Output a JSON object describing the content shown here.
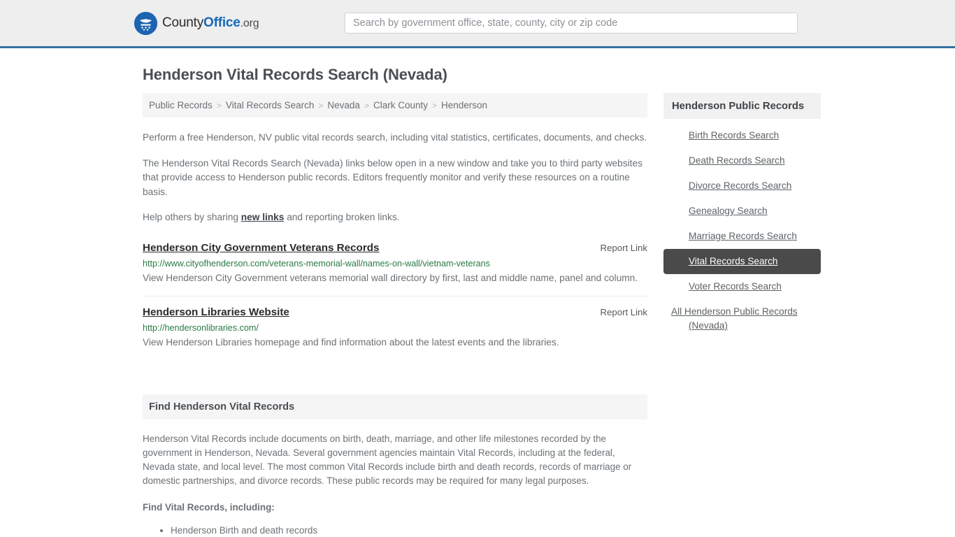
{
  "header": {
    "brand": {
      "part1": "County",
      "part2": "Office",
      "part3": ".org",
      "icon": "eagle-shield-logo"
    },
    "search": {
      "placeholder": "Search by government office, state, county, city or zip code",
      "value": ""
    }
  },
  "page": {
    "title": "Henderson Vital Records Search (Nevada)"
  },
  "breadcrumb": {
    "items": [
      {
        "label": "Public Records"
      },
      {
        "label": "Vital Records Search"
      },
      {
        "label": "Nevada"
      },
      {
        "label": "Clark County"
      },
      {
        "label": "Henderson"
      }
    ],
    "separator": ">"
  },
  "intro": {
    "p1": "Perform a free Henderson, NV public vital records search, including vital statistics, certificates, documents, and checks.",
    "p2": "The Henderson Vital Records Search (Nevada) links below open in a new window and take you to third party websites that provide access to Henderson public records. Editors frequently monitor and verify these resources on a routine basis.",
    "p3_before": "Help others by sharing ",
    "p3_link": "new links",
    "p3_after": " and reporting broken links."
  },
  "results": [
    {
      "title": "Henderson City Government Veterans Records",
      "report_label": "Report Link",
      "url": "http://www.cityofhenderson.com/veterans-memorial-wall/names-on-wall/vietnam-veterans",
      "description": "View Henderson City Government veterans memorial wall directory by first, last and middle name, panel and column."
    },
    {
      "title": "Henderson Libraries Website",
      "report_label": "Report Link",
      "url": "http://hendersonlibraries.com/",
      "description": "View Henderson Libraries homepage and find information about the latest events and the libraries."
    }
  ],
  "find_section": {
    "heading": "Find Henderson Vital Records",
    "body": "Henderson Vital Records include documents on birth, death, marriage, and other life milestones recorded by the government in Henderson, Nevada. Several government agencies maintain Vital Records, including at the federal, Nevada state, and local level. The most common Vital Records include birth and death records, records of marriage or domestic partnerships, and divorce records. These public records may be required for many legal purposes.",
    "subheading": "Find Vital Records, including:",
    "items": [
      "Henderson Birth and death records"
    ]
  },
  "sidebar": {
    "heading": "Henderson Public Records",
    "items": [
      {
        "label": "Birth Records Search",
        "active": false
      },
      {
        "label": "Death Records Search",
        "active": false
      },
      {
        "label": "Divorce Records Search",
        "active": false
      },
      {
        "label": "Genealogy Search",
        "active": false
      },
      {
        "label": "Marriage Records Search",
        "active": false
      },
      {
        "label": "Vital Records Search",
        "active": true
      },
      {
        "label": "Voter Records Search",
        "active": false
      },
      {
        "label": "All Henderson Public Records (Nevada)",
        "active": false
      }
    ]
  },
  "colors": {
    "header_bg": "#eeeeee",
    "header_rule": "#35719f",
    "brand_blue": "#1668b8",
    "panel_bg": "#f5f5f5",
    "active_bg": "#4a4a4a",
    "url_green": "#2a7a42",
    "body_text": "#6c7175"
  }
}
